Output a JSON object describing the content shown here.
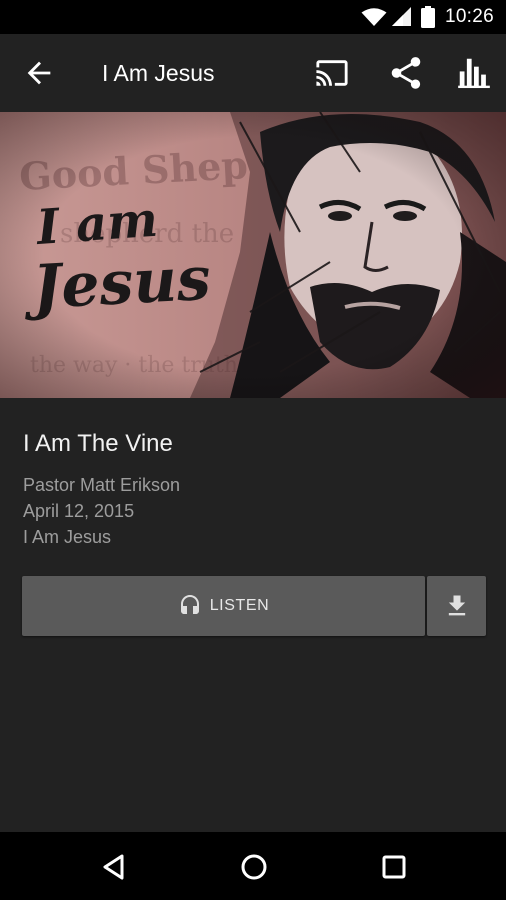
{
  "status_bar": {
    "time": "10:26",
    "icons": [
      "wifi-icon",
      "signal-icon",
      "battery-icon"
    ]
  },
  "toolbar": {
    "title": "I Am Jesus",
    "icons": [
      "back-arrow-icon",
      "cast-icon",
      "share-icon",
      "bar-chart-icon"
    ]
  },
  "hero": {
    "artwork_text": "I am Jesus",
    "background_words": "Good Shepherd"
  },
  "sermon": {
    "title": "I Am The Vine",
    "speaker": "Pastor Matt Erikson",
    "date": "April 12, 2015",
    "series": "I Am Jesus"
  },
  "actions": {
    "listen_label": "LISTEN",
    "listen_icon": "headphones-icon",
    "download_icon": "download-icon"
  },
  "nav_bar": {
    "icons": [
      "nav-back-icon",
      "nav-home-icon",
      "nav-recents-icon"
    ]
  },
  "colors": {
    "background": "#222222",
    "button": "#5a5a5a",
    "muted_text": "#9d9d9d"
  }
}
